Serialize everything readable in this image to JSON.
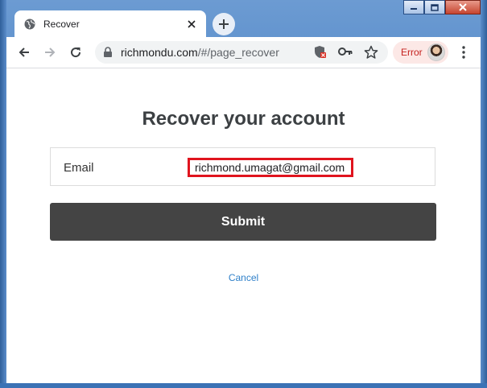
{
  "browser": {
    "tab": {
      "title": "Recover"
    },
    "address_bar": {
      "host": "richmondu.com",
      "path": "/#/page_recover"
    },
    "profile_chip": {
      "label": "Error"
    }
  },
  "page": {
    "title": "Recover your account",
    "email_field": {
      "label": "Email",
      "value": "richmond.umagat@gmail.com"
    },
    "submit_label": "Submit",
    "cancel_label": "Cancel"
  },
  "icons": {
    "tab": "globe-icon",
    "tab_close": "close-icon",
    "new_tab": "plus-icon",
    "back": "arrow-left-icon",
    "forward": "arrow-right-icon",
    "reload": "reload-icon",
    "lock": "lock-icon",
    "security": "shield-icon",
    "passwords": "key-icon",
    "bookmark": "star-icon",
    "menu": "kebab-menu-icon"
  },
  "colors": {
    "accent_highlight": "#e0141e",
    "submit_background": "#444444",
    "link": "#2f80c9",
    "error_chip_bg": "#fce8e6",
    "error_chip_text": "#c5221f"
  }
}
